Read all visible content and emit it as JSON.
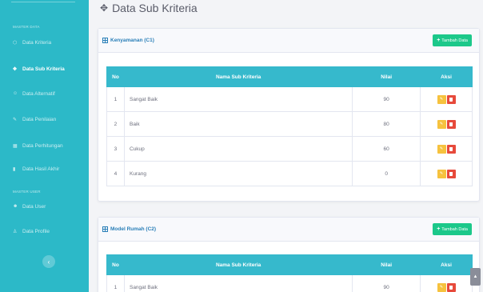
{
  "sidebar": {
    "heading_master_data": "MASTER DATA",
    "heading_master_user": "MASTER USER",
    "items": [
      {
        "label": "Data Kriteria",
        "icon": "cube-icon"
      },
      {
        "label": "Data Sub Kriteria",
        "icon": "cubes-icon"
      },
      {
        "label": "Data Alternatif",
        "icon": "users-icon"
      },
      {
        "label": "Data Penilaian",
        "icon": "edit-icon"
      },
      {
        "label": "Data Perhitungan",
        "icon": "calculator-icon"
      },
      {
        "label": "Data Hasil Akhir",
        "icon": "chart-icon"
      },
      {
        "label": "Data User",
        "icon": "user-group-icon"
      },
      {
        "label": "Data Profile",
        "icon": "user-icon"
      }
    ],
    "toggle_glyph": "‹"
  },
  "page": {
    "title": "Data Sub Kriteria"
  },
  "tables": {
    "headers": {
      "no": "No",
      "nama": "Nama Sub Kriteria",
      "nilai": "Nilai",
      "aksi": "Aksi"
    },
    "add_label": "Tambah Data",
    "card1": {
      "title": "Kenyamanan (C1)",
      "rows": [
        {
          "no": "1",
          "nama": "Sangat Baik",
          "nilai": "90"
        },
        {
          "no": "2",
          "nama": "Baik",
          "nilai": "80"
        },
        {
          "no": "3",
          "nama": "Cukup",
          "nilai": "60"
        },
        {
          "no": "4",
          "nama": "Kurang",
          "nilai": "0"
        }
      ]
    },
    "card2": {
      "title": "Model Rumah (C2)",
      "rows": [
        {
          "no": "1",
          "nama": "Sangat Baik",
          "nilai": "90"
        }
      ]
    }
  },
  "colors": {
    "sidebar": "#2cb9c8",
    "table_header": "#36b9cc",
    "add_button": "#1cc88a",
    "edit_button": "#f6c23e",
    "delete_button": "#e74a3b"
  }
}
